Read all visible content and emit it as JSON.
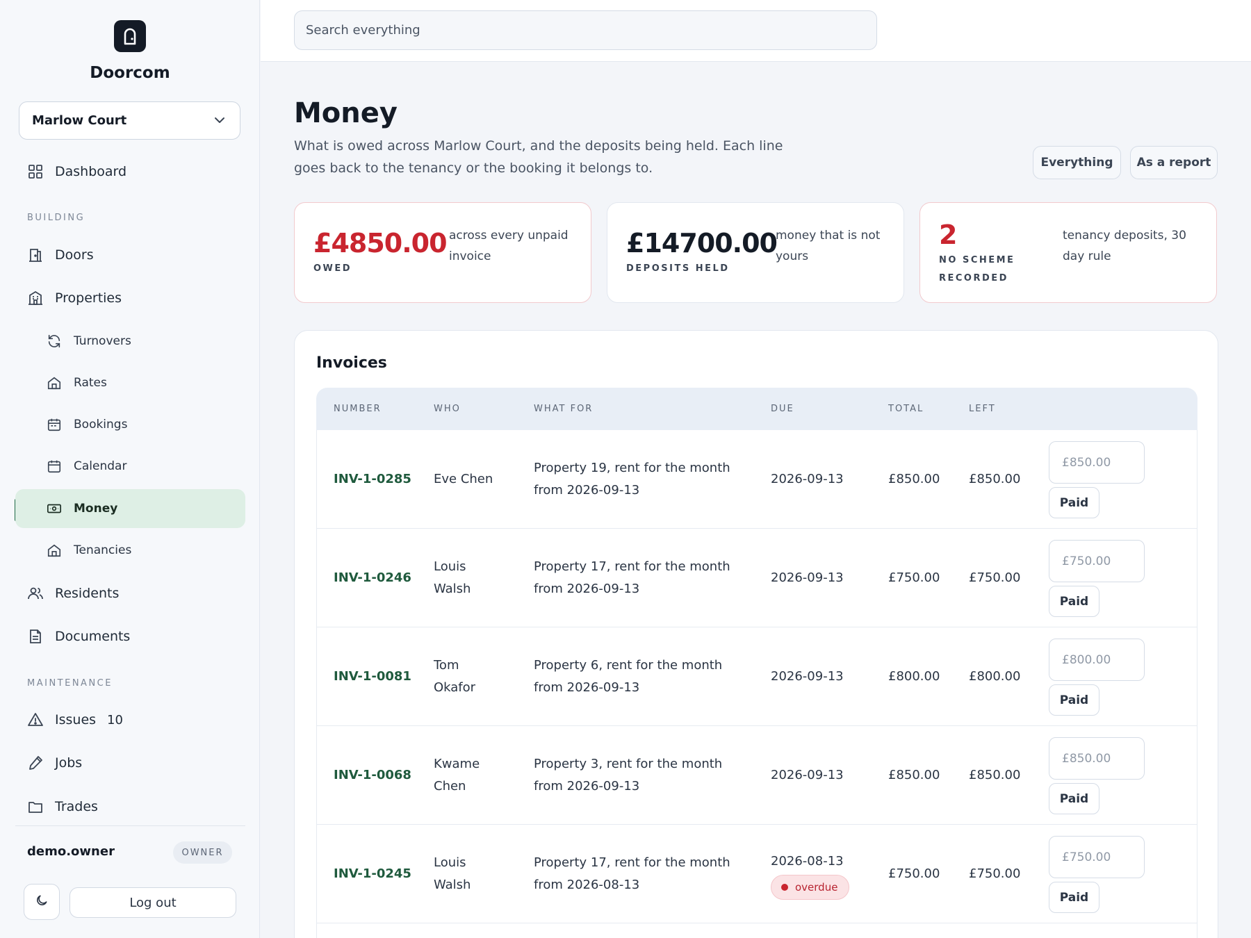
{
  "brand": {
    "name": "Doorcom"
  },
  "property_select": {
    "value": "Marlow Court"
  },
  "nav": {
    "dashboard": "Dashboard",
    "building_label": "BUILDING",
    "doors": "Doors",
    "properties": "Properties",
    "turnovers": "Turnovers",
    "rates": "Rates",
    "bookings": "Bookings",
    "calendar": "Calendar",
    "money": "Money",
    "tenancies": "Tenancies",
    "residents": "Residents",
    "documents": "Documents",
    "maintenance_label": "MAINTENANCE",
    "issues": "Issues",
    "issues_count": "10",
    "jobs": "Jobs",
    "trades": "Trades"
  },
  "user": {
    "name": "demo.owner",
    "role": "OWNER",
    "logout": "Log out"
  },
  "search": {
    "placeholder": "Search everything"
  },
  "page": {
    "title": "Money",
    "description": "What is owed across Marlow Court, and the deposits being held. Each line goes back to the tenancy or the booking it belongs to.",
    "views": [
      "Everything",
      "As a report"
    ]
  },
  "stats": [
    {
      "value": "£4850.00",
      "label": "OWED",
      "note": "across every unpaid invoice",
      "alert": true
    },
    {
      "value": "£14700.00",
      "label": "DEPOSITS HELD",
      "note": "money that is not yours",
      "alert": false
    },
    {
      "value": "2",
      "label": "NO SCHEME RECORDED",
      "note": "tenancy deposits, 30 day rule",
      "alert": true
    }
  ],
  "invoices": {
    "title": "Invoices",
    "columns": [
      "NUMBER",
      "WHO",
      "WHAT FOR",
      "DUE",
      "TOTAL",
      "LEFT"
    ],
    "paid_label": "Paid",
    "rows": [
      {
        "number": "INV-1-0285",
        "who": "Eve Chen",
        "what_for": "Property 19, rent for the month from 2026-09-13",
        "due": "2026-09-13",
        "total": "£850.00",
        "left": "£850.00",
        "amount_placeholder": "£850.00",
        "status": ""
      },
      {
        "number": "INV-1-0246",
        "who": "Louis Walsh",
        "what_for": "Property 17, rent for the month from 2026-09-13",
        "due": "2026-09-13",
        "total": "£750.00",
        "left": "£750.00",
        "amount_placeholder": "£750.00",
        "status": ""
      },
      {
        "number": "INV-1-0081",
        "who": "Tom Okafor",
        "what_for": "Property 6, rent for the month from 2026-09-13",
        "due": "2026-09-13",
        "total": "£800.00",
        "left": "£800.00",
        "amount_placeholder": "£800.00",
        "status": ""
      },
      {
        "number": "INV-1-0068",
        "who": "Kwame Chen",
        "what_for": "Property 3, rent for the month from 2026-09-13",
        "due": "2026-09-13",
        "total": "£850.00",
        "left": "£850.00",
        "amount_placeholder": "£850.00",
        "status": ""
      },
      {
        "number": "INV-1-0245",
        "who": "Louis Walsh",
        "what_for": "Property 17, rent for the month from 2026-08-13",
        "due": "2026-08-13",
        "total": "£750.00",
        "left": "£750.00",
        "amount_placeholder": "£750.00",
        "status": "overdue"
      }
    ]
  },
  "colors": {
    "accent": "#1f6b46",
    "alert": "#c9252f",
    "active_nav_bg": "#deefe5"
  },
  "icons": [
    "doorcom-logo-icon",
    "chevron-down-icon",
    "dashboard-grid-icon",
    "door-icon",
    "building-icon",
    "refresh-icon",
    "home-icon",
    "calendar-icon",
    "banknote-icon",
    "users-icon",
    "document-icon",
    "warning-icon",
    "pen-icon",
    "folder-icon",
    "moon-icon"
  ]
}
